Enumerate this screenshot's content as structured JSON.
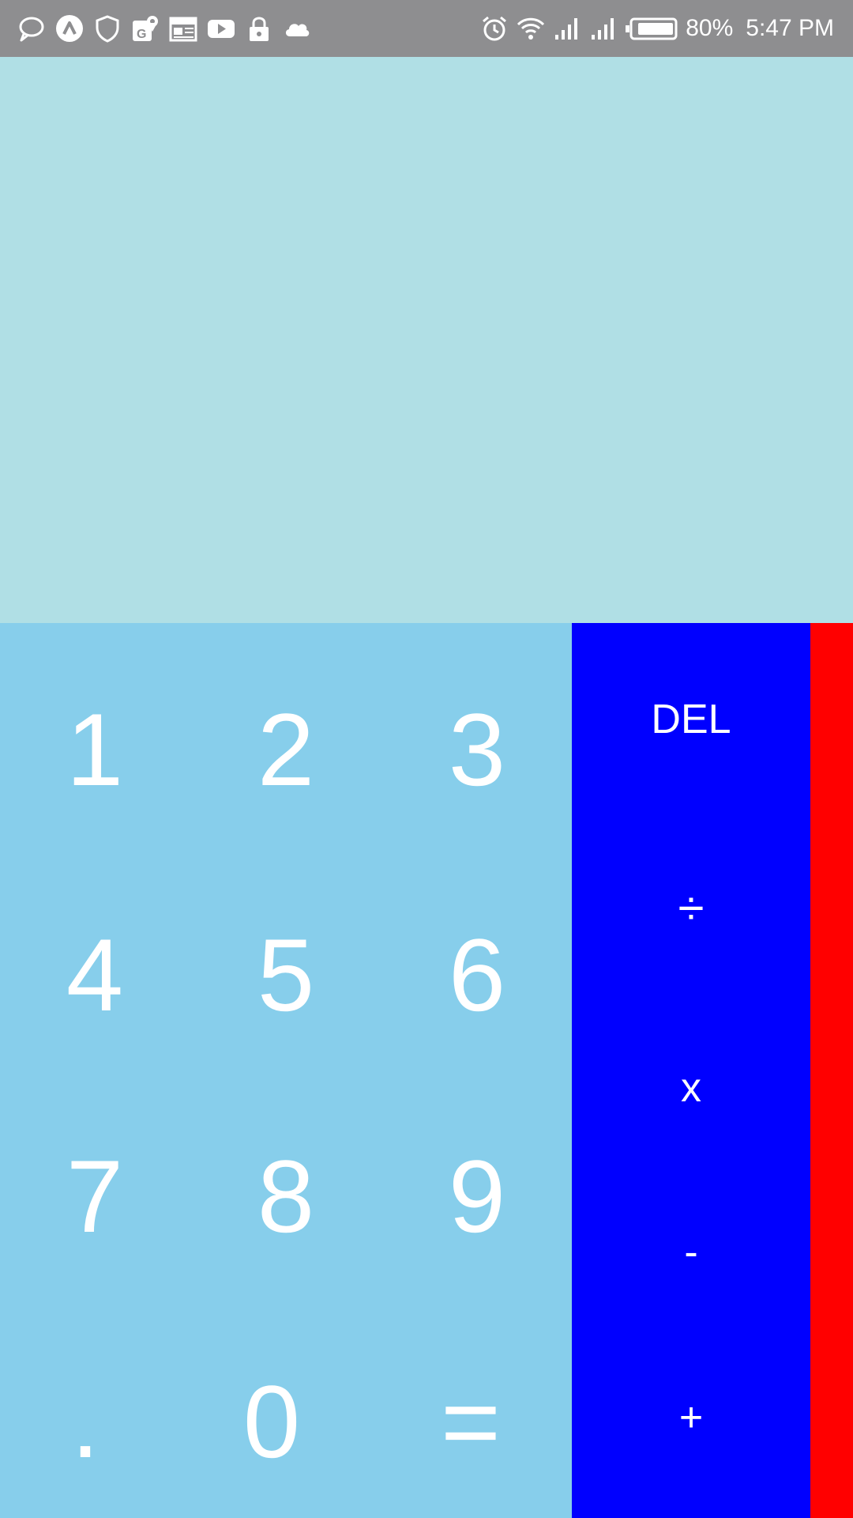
{
  "status_bar": {
    "background": "#8e8e90",
    "left_icons": [
      "chat-bubble-icon",
      "app-badge-icon",
      "shield-icon",
      "maps-icon",
      "news-icon",
      "youtube-icon",
      "lock-icon",
      "cloud-icon"
    ],
    "right_icons": [
      "alarm-icon",
      "wifi-icon",
      "signal-icon",
      "signal-icon",
      "battery-icon"
    ],
    "battery": "80%",
    "time": "5:47 PM"
  },
  "display": {
    "value": "",
    "background": "#b0dfe5"
  },
  "numpad": {
    "background": "#87ceeb",
    "keys": [
      "1",
      "2",
      "3",
      "4",
      "5",
      "6",
      "7",
      "8",
      "9",
      ".",
      "0",
      "="
    ]
  },
  "operators": {
    "background": "#0000ff",
    "del": "DEL",
    "divide": "÷",
    "multiply": "x",
    "minus": "-",
    "plus": "+"
  },
  "side_strip": {
    "background": "#ff0000"
  }
}
